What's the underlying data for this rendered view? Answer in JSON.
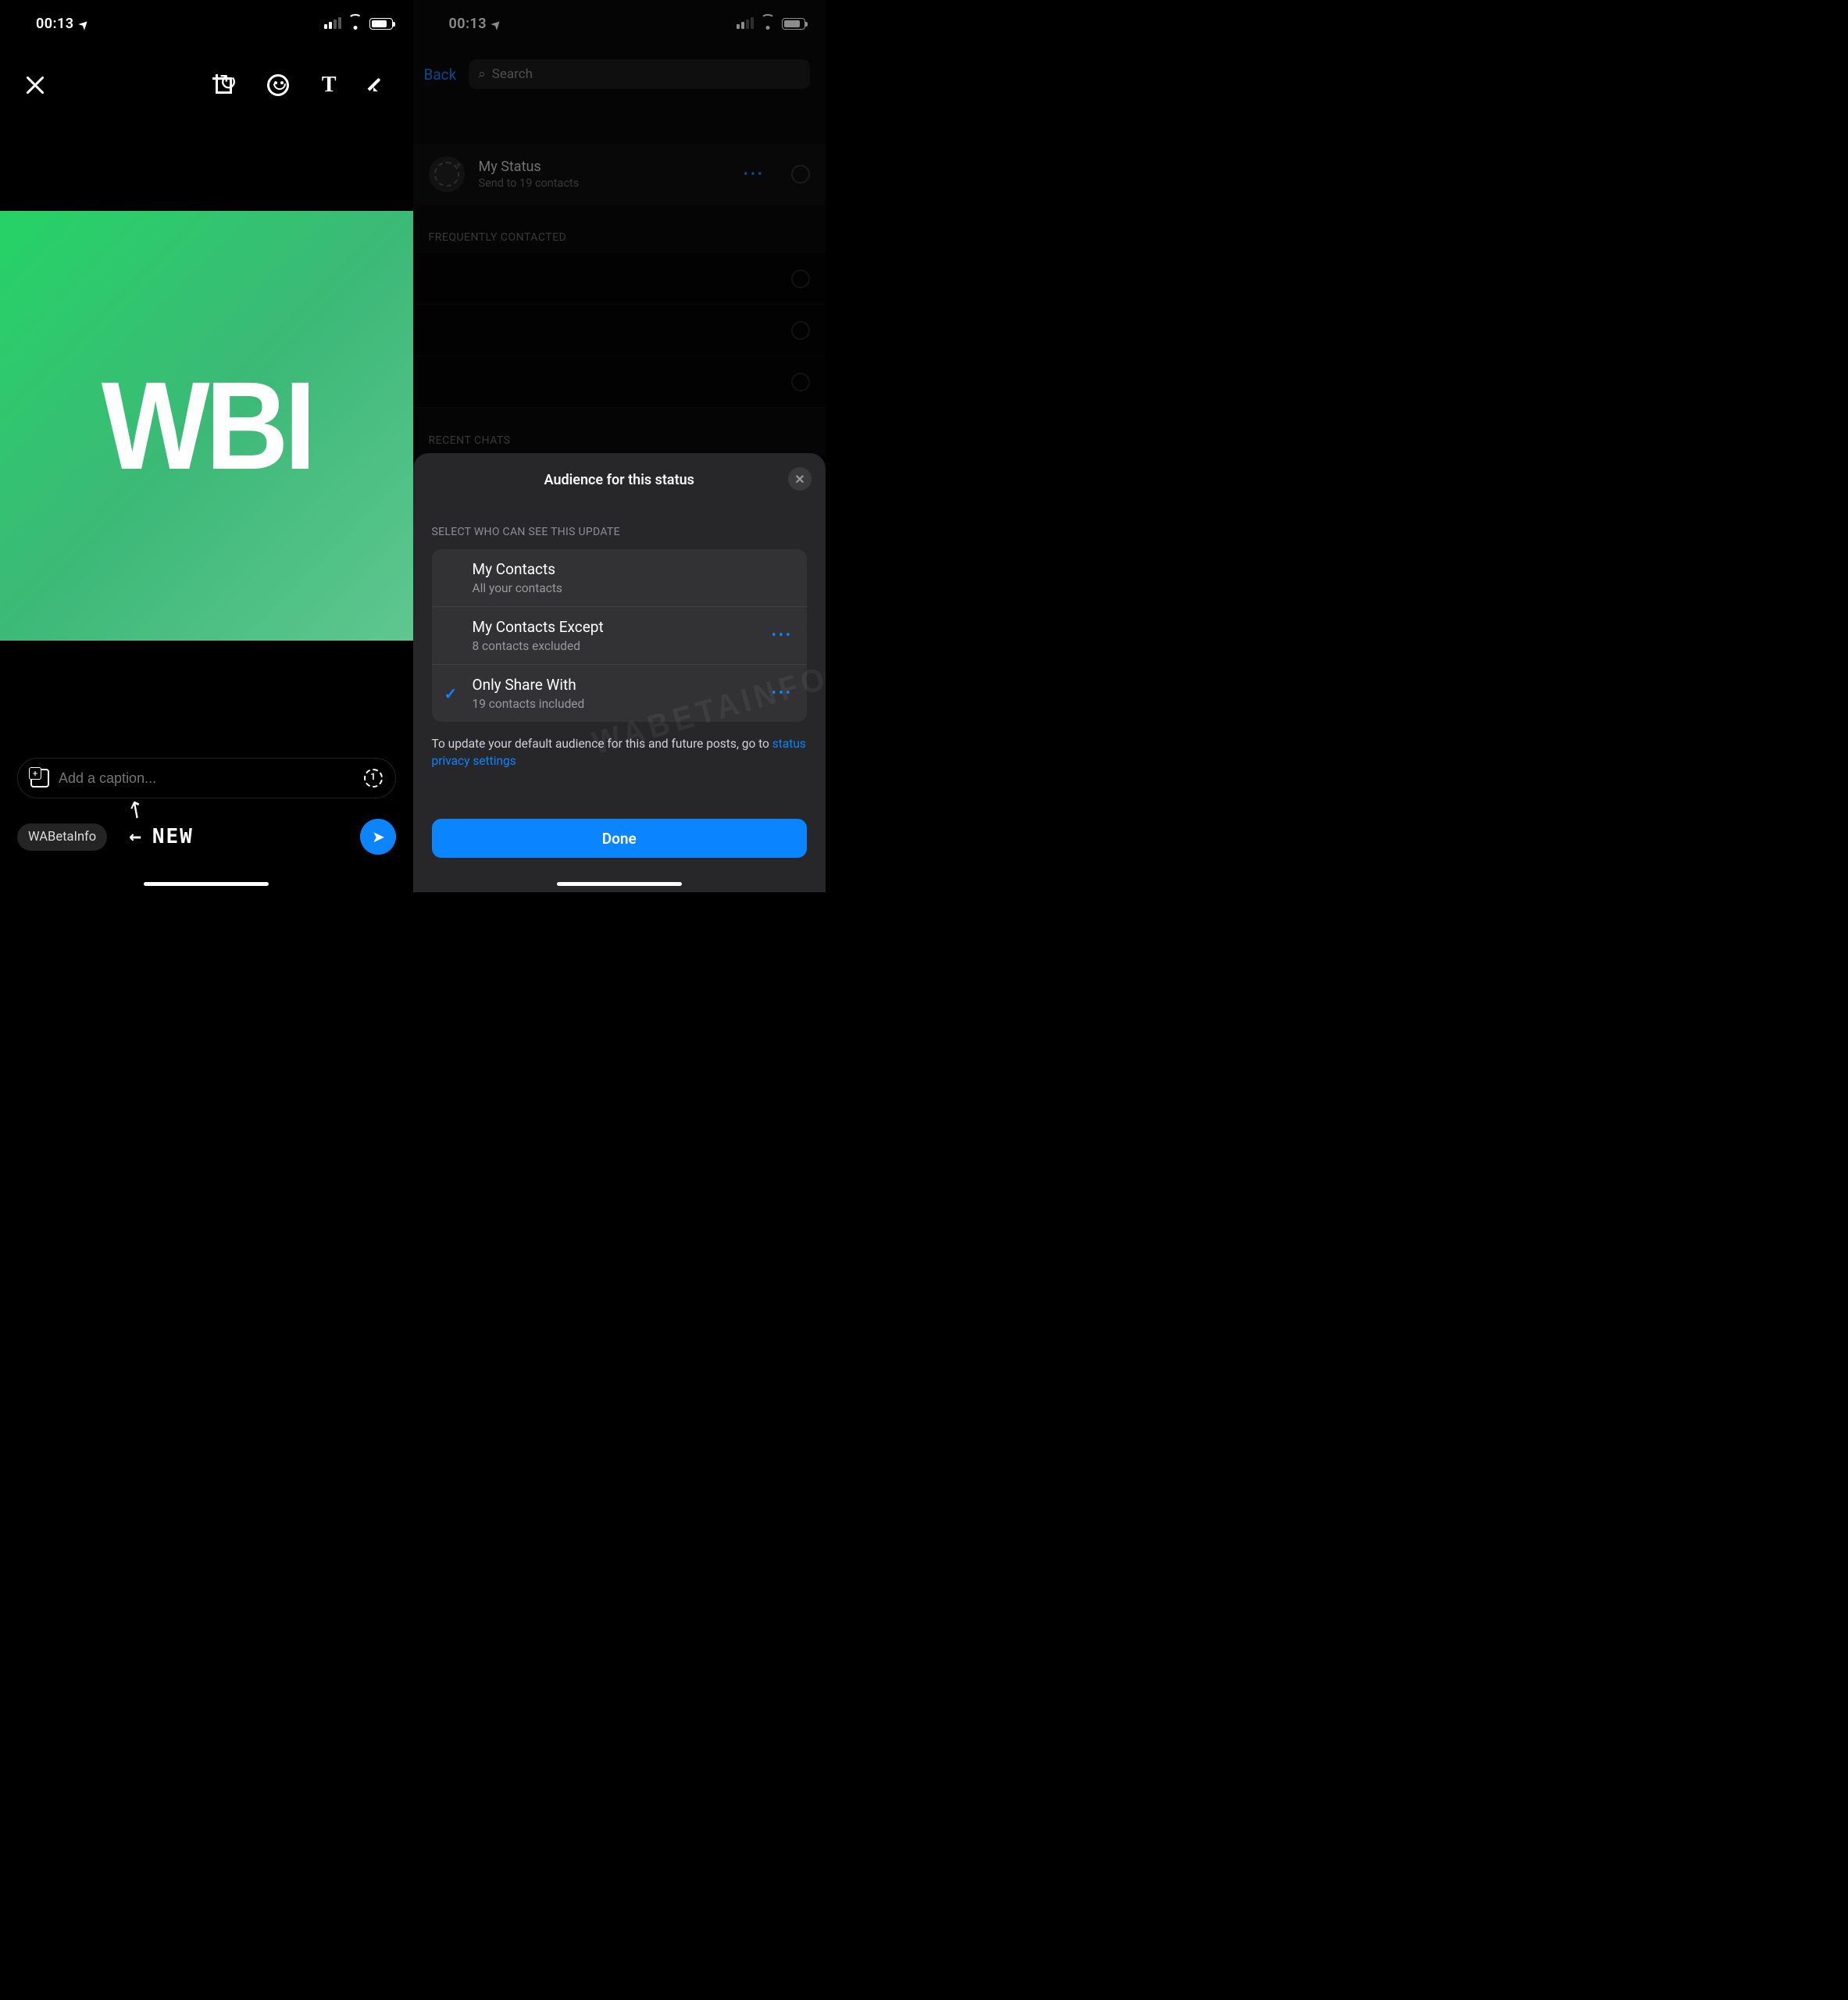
{
  "statusbar": {
    "time": "00:13"
  },
  "left": {
    "caption_placeholder": "Add a caption...",
    "chip": "WABetaInfo",
    "new_label": "NEW",
    "logo_text": "WBI"
  },
  "right": {
    "back": "Back",
    "search_placeholder": "Search",
    "my_status": {
      "title": "My Status",
      "sub": "Send to 19 contacts"
    },
    "sect_freq": "FREQUENTLY CONTACTED",
    "sect_recent": "RECENT CHATS"
  },
  "sheet": {
    "title": "Audience for this status",
    "sect": "SELECT WHO CAN SEE THIS UPDATE",
    "options": [
      {
        "t": "My Contacts",
        "s": "All your contacts"
      },
      {
        "t": "My Contacts Except",
        "s": "8 contacts excluded"
      },
      {
        "t": "Only Share With",
        "s": "19 contacts included"
      }
    ],
    "note_pre": "To update your default audience for this and future posts, go to ",
    "note_link": "status privacy settings",
    "done": "Done"
  },
  "watermark": "WABETAINFO"
}
